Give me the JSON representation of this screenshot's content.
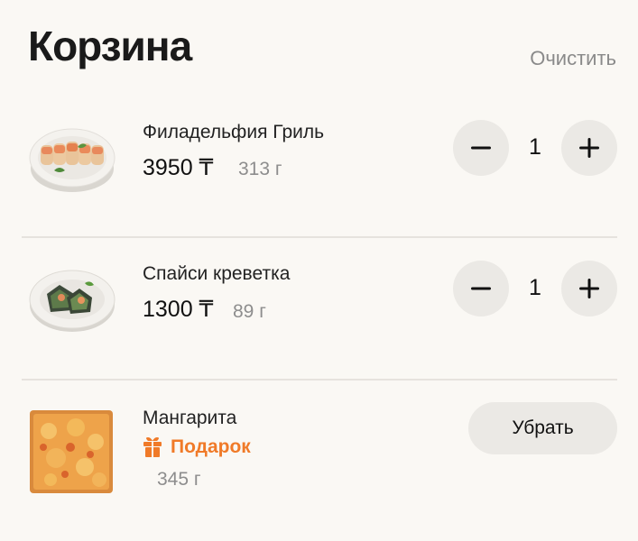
{
  "header": {
    "title": "Корзина",
    "clear_label": "Очистить"
  },
  "items": [
    {
      "name": "Филадельфия Гриль",
      "price": "3950 ₸",
      "weight": "313 г",
      "quantity": "1",
      "image": "sushi-rolls-plate"
    },
    {
      "name": "Спайси креветка",
      "price": "1300 ₸",
      "weight": "89 г",
      "quantity": "1",
      "image": "shrimp-sushi-plate"
    },
    {
      "name": "Мангарита",
      "gift_label": "Подарок",
      "weight": "345 г",
      "remove_label": "Убрать",
      "image": "square-pizza"
    }
  ],
  "colors": {
    "accent": "#f07a28",
    "background": "#faf8f4",
    "button_bg": "#ebe9e5",
    "muted_text": "#8d8d8d"
  }
}
